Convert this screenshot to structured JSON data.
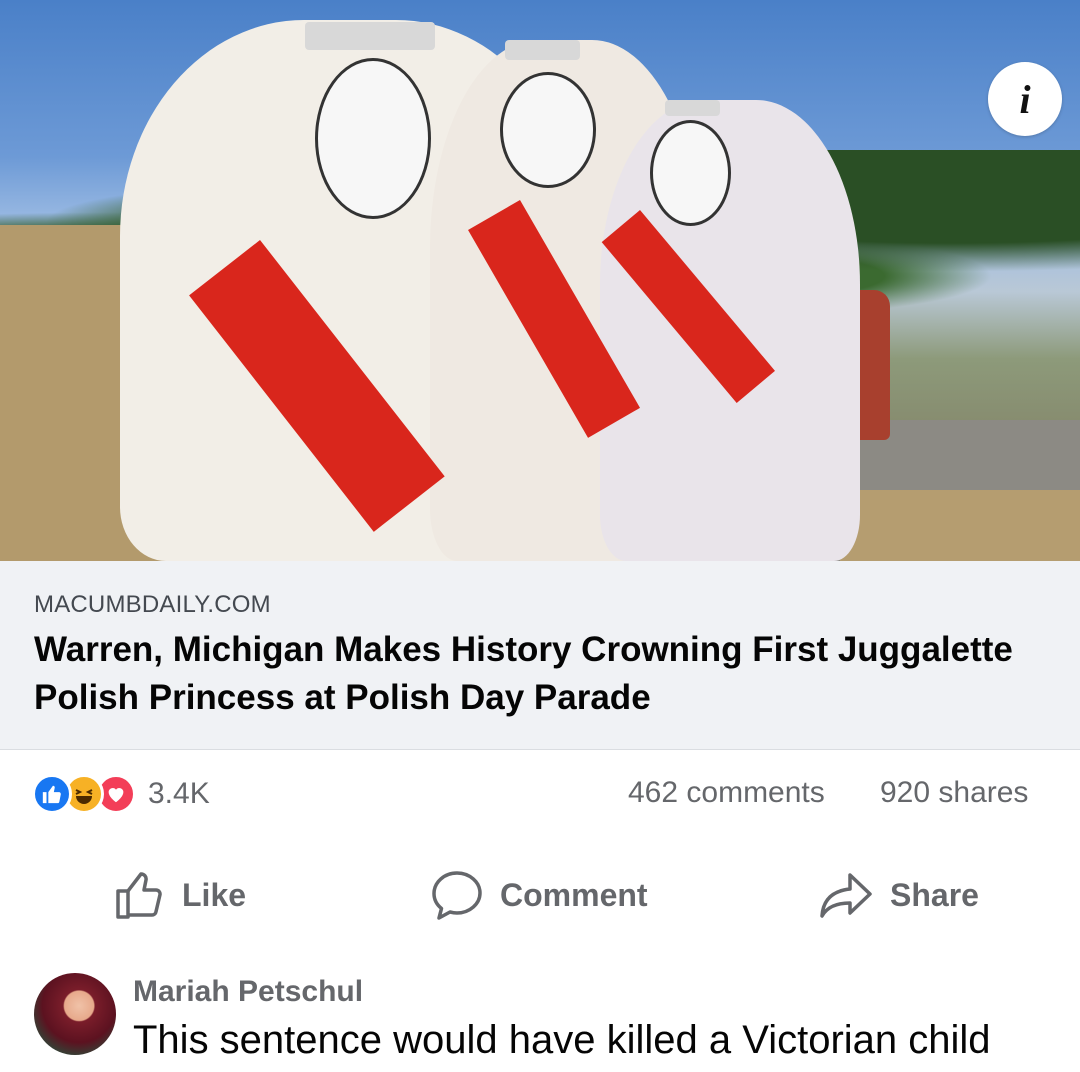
{
  "post": {
    "info_icon": "i"
  },
  "link_preview": {
    "domain": "MACUMBDAILY.COM",
    "headline": "Warren, Michigan Makes History Crowning First Juggalette Polish Princess at Polish Day Parade"
  },
  "engagement": {
    "reaction_icons": [
      "like-icon",
      "haha-icon",
      "love-icon"
    ],
    "reaction_count": "3.4K",
    "comments": "462 comments",
    "shares": "920 shares"
  },
  "actions": {
    "like": "Like",
    "comment": "Comment",
    "share": "Share"
  },
  "comment": {
    "author": "Mariah Petschul",
    "text": "This sentence would have killed a Victorian child"
  },
  "colors": {
    "link_background": "#f0f2f5",
    "like_blue": "#1877f2",
    "haha_yellow": "#f7b125",
    "love_red": "#f33e58",
    "secondary_text": "#65676b"
  }
}
